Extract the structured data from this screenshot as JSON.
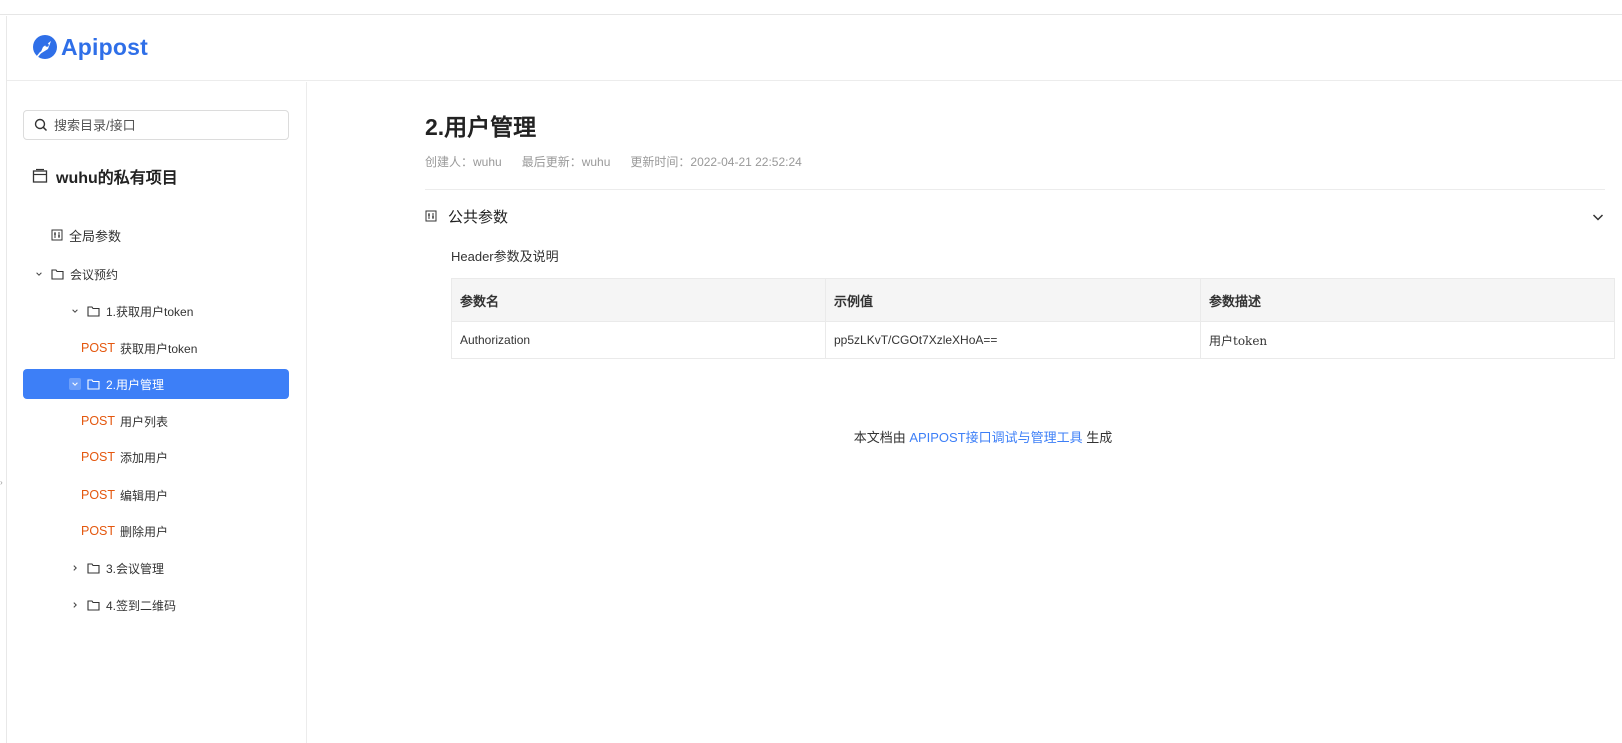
{
  "app": {
    "logo_text": "Apipost",
    "brand_color": "#2f6fe8",
    "accent_color": "#3d7ff7",
    "method_color": "#e4570e"
  },
  "sidebar": {
    "search_placeholder": "搜索目录/接口",
    "project_name": "wuhu的私有项目",
    "items": [
      {
        "type": "global",
        "icon": "global-params-icon",
        "label": "全局参数"
      },
      {
        "type": "folder",
        "expanded": true,
        "label": "会议预约"
      },
      {
        "type": "folder",
        "expanded": true,
        "label": "1.获取用户token"
      },
      {
        "type": "api",
        "method": "POST",
        "label": "获取用户token"
      },
      {
        "type": "folder",
        "expanded": true,
        "active": true,
        "label": "2.用户管理"
      },
      {
        "type": "api",
        "method": "POST",
        "label": "用户列表"
      },
      {
        "type": "api",
        "method": "POST",
        "label": "添加用户"
      },
      {
        "type": "api",
        "method": "POST",
        "label": "编辑用户"
      },
      {
        "type": "api",
        "method": "POST",
        "label": "删除用户"
      },
      {
        "type": "folder",
        "expanded": false,
        "label": "3.会议管理"
      },
      {
        "type": "folder",
        "expanded": false,
        "label": "4.签到二维码"
      }
    ]
  },
  "main": {
    "title": "2.用户管理",
    "meta": {
      "creator": "创建人：wuhu",
      "updater": "最后更新：wuhu",
      "updated_time": "更新时间：2022-04-21 22:52:24"
    },
    "section": {
      "title": "公共参数",
      "subtitle": "Header参数及说明",
      "columns": [
        "参数名",
        "示例值",
        "参数描述"
      ],
      "rows": [
        [
          "Authorization",
          "pp5zLKvT/CGOt7XzleXHoA==",
          "用户token"
        ]
      ]
    },
    "footer": {
      "prefix": "本文档由 ",
      "link": "APIPOST接口调试与管理工具",
      "suffix": " 生成"
    }
  }
}
